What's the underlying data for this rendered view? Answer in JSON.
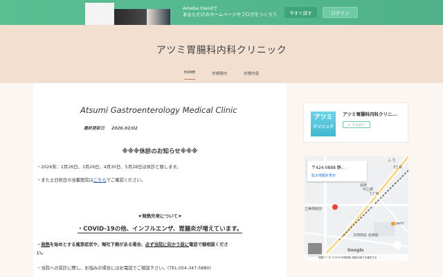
{
  "ad": {
    "line1": "Ameba Owndで",
    "line2": "あなただけのホームページやブログをつくろう",
    "try_label": "今すぐ試す",
    "login_label": "ログイン"
  },
  "site": {
    "title": "アツミ胃腸科内科クリニック",
    "nav": [
      "HOME",
      "診療案内",
      "診療内容"
    ]
  },
  "main": {
    "clinic_en": "Atsumi Gastroenterology Medical Clinic",
    "updated_label": "最終更新日",
    "updated_date": "2026.02/02",
    "notice_title": "※※※休診のお知らせ※※※",
    "closed_days": "・2026年：2月26日、3月26日、4月30日、5月28日は休診と致します。",
    "holiday_pre": "・また土日祝日の当番医院は",
    "holiday_link": "こちら",
    "holiday_post": "でご確認ください。",
    "fever_title": "★発熱外来について★",
    "covid_line": "・COVID-19の他、インフルエンザ、胃腸炎が増えています。",
    "fever_text1": "・",
    "fever_u1": "発熱",
    "fever_text2": "を始めとする風邪症状や、嘔吐下痢がある場合、",
    "fever_u2": "必ず当院に向かう前に",
    "fever_text3": "電話で御相談くださ",
    "fever_text4": "い。",
    "phone_line": "・当院への受診に際し、お悩みの場合にはお電話でご相談下さい。(TEL:054-347-5880)"
  },
  "sidebar": {
    "logo_big": "アツミ",
    "logo_small": "クリニック",
    "name": "アツミ胃腸科内科クリニ...",
    "follow_label": "＋ フォロー",
    "map_address": "〒424-0888 静...",
    "map_link": "拡大地図を表示",
    "map_labels": [
      "中之郷",
      "1丁目",
      "谷田",
      "文田商店 谷田店",
      "立美術館前",
      "petit",
      "ふ ち",
      "3丁目"
    ],
    "map_footer": "地図データ ©2026   利用規約   地図の誤りを報告する",
    "google": "Google"
  }
}
